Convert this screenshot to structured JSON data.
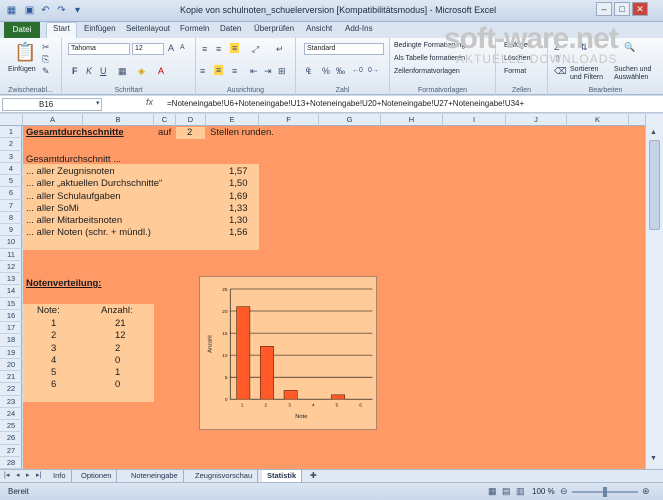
{
  "window": {
    "title": "Kopie von schulnoten_schuelerversion  [Kompatibilitätsmodus]  -  Microsoft Excel",
    "buttons": [
      "–",
      "□",
      "✕"
    ]
  },
  "tabs": [
    "Datei",
    "Start",
    "Einfügen",
    "Seitenlayout",
    "Formeln",
    "Daten",
    "Überprüfen",
    "Ansicht",
    "Add-Ins"
  ],
  "ribbon": {
    "groups": [
      "Zwischenabl...",
      "Schriftart",
      "Ausrichtung",
      "Zahl",
      "Formatvorlagen",
      "Zellen",
      "Bearbeiten"
    ],
    "paste_label": "Einfügen",
    "font_name": "Tahoma",
    "font_size": "12",
    "number_format": "Standard",
    "fmt_items": [
      "Bedingte Formatierung",
      "Als Tabelle formatieren",
      "Zellenformatvorlagen"
    ],
    "cell_items": [
      "Einfügen",
      "Löschen",
      "Format"
    ],
    "edit_items": [
      "Sortieren und Filtern",
      "Suchen und Auswählen"
    ],
    "edit_labels": [
      "Sortieren",
      "und Filtern",
      "Suchen und",
      "Auswählen"
    ],
    "bold": "F",
    "italic": "K",
    "underline": "U"
  },
  "formula_bar": {
    "cell_ref": "B16",
    "fx": "fx",
    "formula": "=Noteneingabe!U6+Noteneingabe!U13+Noteneingabe!U20+Noteneingabe!U27+Noteneingabe!U34+"
  },
  "columns": [
    "A",
    "B",
    "C",
    "D",
    "E",
    "F",
    "G",
    "H",
    "I",
    "J",
    "K"
  ],
  "rows": [
    "1",
    "2",
    "3",
    "4",
    "5",
    "6",
    "7",
    "8",
    "9",
    "10",
    "11",
    "12",
    "13",
    "14",
    "15",
    "16",
    "17",
    "18",
    "19",
    "20",
    "21",
    "22",
    "23",
    "24",
    "25",
    "26",
    "27",
    "28"
  ],
  "sheet": {
    "title": "Gesamtdurchschnitte",
    "auf": "auf",
    "decimals": "2",
    "round_label": "Stellen runden.",
    "avg_header": "Gesamtdurchschnitt ...",
    "averages": [
      {
        "label": "... aller Zeugnisnoten",
        "value": "1,57"
      },
      {
        "label": "... aller „aktuellen Durchschnitte“",
        "value": "1,50"
      },
      {
        "label": "... aller Schulaufgaben",
        "value": "1,69"
      },
      {
        "label": "... aller SoMi",
        "value": "1,33"
      },
      {
        "label": "... aller Mitarbeitsnoten",
        "value": "1,30"
      },
      {
        "label": "... aller Noten (schr. + mündl.)",
        "value": "1,56"
      }
    ],
    "dist_title": "Notenverteilung:",
    "dist_headers": [
      "Note:",
      "Anzahl:"
    ],
    "dist_rows": [
      {
        "note": "1",
        "count": "21"
      },
      {
        "note": "2",
        "count": "12"
      },
      {
        "note": "3",
        "count": "2"
      },
      {
        "note": "4",
        "count": "0"
      },
      {
        "note": "5",
        "count": "1"
      },
      {
        "note": "6",
        "count": "0"
      }
    ]
  },
  "sheet_tabs": [
    "Info",
    "Optionen",
    "Noteneingabe",
    "Zeugnisvorschau",
    "Statistik"
  ],
  "active_sheet": "Statistik",
  "status": {
    "left": "Bereit",
    "zoom": "100 %"
  },
  "watermark": {
    "line1": "soft-ware.net",
    "line2": "AKTUELLE DOWNLOADS"
  },
  "chart_data": {
    "type": "bar",
    "categories": [
      "1",
      "2",
      "3",
      "4",
      "5",
      "6"
    ],
    "values": [
      21,
      12,
      2,
      0,
      1,
      0
    ],
    "xlabel": "Note",
    "ylabel": "Anzahl",
    "ylim": [
      0,
      25
    ],
    "yticks": [
      "0",
      "5",
      "10",
      "15",
      "20",
      "25"
    ],
    "bar_color": "#ff5a28",
    "plot_bg": "#ffcc99",
    "grid": true
  }
}
